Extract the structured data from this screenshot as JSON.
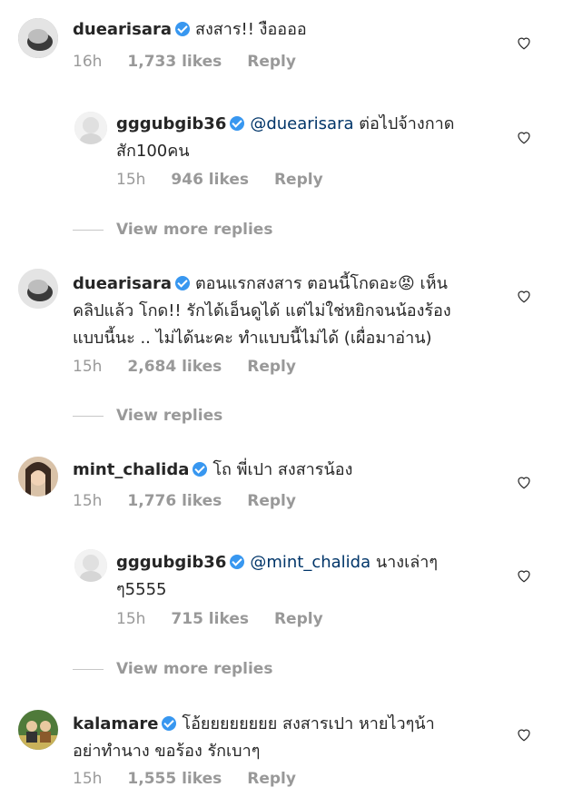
{
  "comments": [
    {
      "username": "duearisara",
      "mention": "",
      "text": "สงสาร!! งืออออ",
      "text2": "",
      "text3": "",
      "time": "16h",
      "likes": "1,733 likes",
      "reply": "Reply"
    },
    {
      "username": "gggubgib36",
      "mention": "@duearisara",
      "text": "ต่อไปจ้างกาด",
      "text2": "สัก100คน",
      "text3": "",
      "time": "15h",
      "likes": "946 likes",
      "reply": "Reply"
    },
    {
      "username": "duearisara",
      "mention": "",
      "text": "ตอนแรกสงสาร ตอนนี้โกดอะ😡 เห็น",
      "text2": "คลิปแล้ว โกด!! รักได้เอ็นดูได้ แต่ไม่ใช่หยิกจนน้องร้อง",
      "text3": "แบบนี้นะ .. ไม่ได้นะคะ ทำแบบนี้ไม่ได้ (เผื่อมาอ่าน)",
      "time": "15h",
      "likes": "2,684 likes",
      "reply": "Reply"
    },
    {
      "username": "mint_chalida",
      "mention": "",
      "text": "โถ พี่เปา สงสารน้อง",
      "text2": "",
      "text3": "",
      "time": "15h",
      "likes": "1,776 likes",
      "reply": "Reply"
    },
    {
      "username": "gggubgib36",
      "mention": "@mint_chalida",
      "text": "นางเล่าๆ",
      "text2": "ๆ5555",
      "text3": "",
      "time": "15h",
      "likes": "715 likes",
      "reply": "Reply"
    },
    {
      "username": "kalamare",
      "mention": "",
      "text": "โอ้ยยยยยยยย สงสารเปา หายไวๆน้า",
      "text2": "อย่าทำนาง ขอร้อง รักเบาๆ",
      "text3": "",
      "time": "15h",
      "likes": "1,555 likes",
      "reply": "Reply"
    }
  ],
  "view_more": [
    "View more replies",
    "View replies",
    "View more replies"
  ]
}
